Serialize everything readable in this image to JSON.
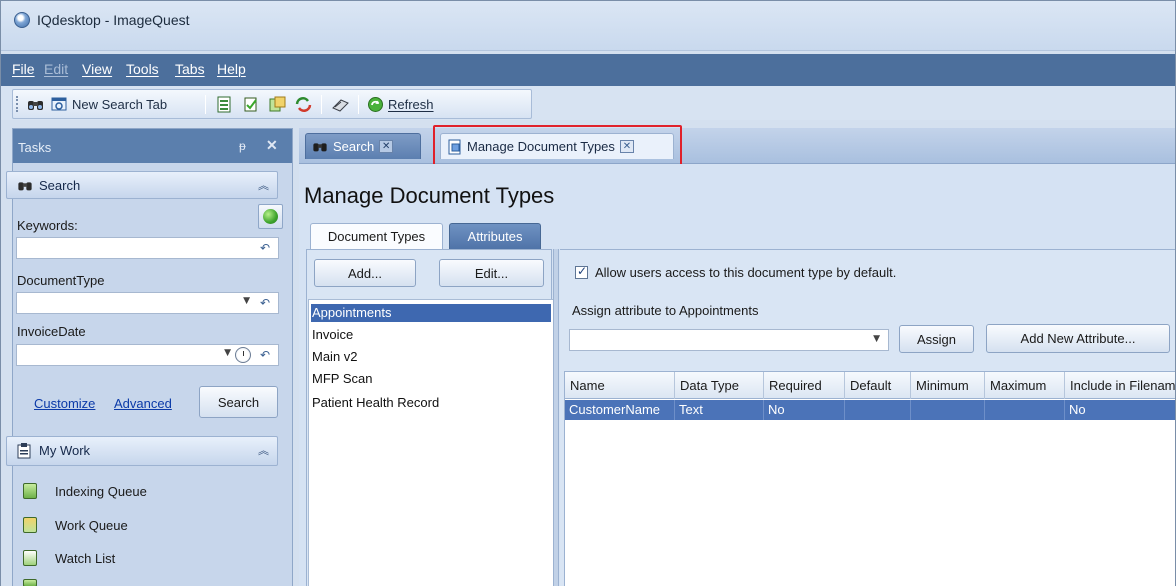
{
  "window": {
    "title": "IQdesktop - ImageQuest"
  },
  "menu": [
    "File",
    "Edit",
    "View",
    "Tools",
    "Tabs",
    "Help"
  ],
  "toolbar": {
    "new_search_tab": "New Search Tab",
    "refresh": "Refresh"
  },
  "tasks": {
    "header": "Tasks",
    "pin_glyph": "ṕ",
    "close_glyph": "✕",
    "search_section": {
      "title": "Search",
      "keywords_label": "Keywords:",
      "keywords_value": "",
      "document_type_label": "DocumentType",
      "document_type_value": "",
      "invoice_date_label": "InvoiceDate",
      "invoice_date_value": "",
      "customize_link": "Customize",
      "advanced_link": "Advanced",
      "search_button": "Search"
    },
    "my_work": {
      "title": "My Work",
      "items": [
        {
          "label": "Indexing Queue",
          "icon": "indexing-queue-icon"
        },
        {
          "label": "Work Queue",
          "icon": "work-queue-icon"
        },
        {
          "label": "Watch List",
          "icon": "watch-list-icon"
        }
      ]
    }
  },
  "doc_tabs": [
    {
      "label": "Search",
      "active": false
    },
    {
      "label": "Manage Document Types",
      "active": true
    }
  ],
  "page": {
    "title": "Manage Document Types",
    "inner_tabs": [
      "Document Types",
      "Attributes"
    ],
    "add_button": "Add...",
    "edit_button": "Edit...",
    "document_types": [
      "Appointments",
      "Invoice",
      "Main v2",
      "MFP Scan",
      "Patient Health Record"
    ],
    "selected_document_type": "Appointments",
    "allow_access_label": "Allow users access to this document type by default.",
    "allow_access_checked": true,
    "assign_label": "Assign attribute to Appointments",
    "assign_combo_value": "",
    "assign_button": "Assign",
    "add_new_attribute_button": "Add New Attribute...",
    "grid": {
      "columns": [
        "Name",
        "Data Type",
        "Required",
        "Default",
        "Minimum",
        "Maximum",
        "Include in Filename"
      ],
      "rows": [
        [
          "CustomerName",
          "Text",
          "No",
          "",
          "",
          "",
          "No"
        ]
      ]
    }
  },
  "colors": {
    "menubar": "#4c6f9c",
    "selection": "#3e68b0",
    "highlight_box": "#e0202a"
  }
}
